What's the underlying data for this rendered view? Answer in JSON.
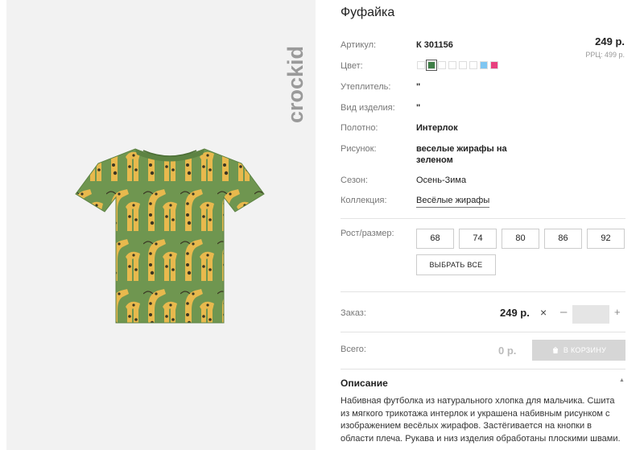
{
  "brand": {
    "logo_text": "crockid"
  },
  "product": {
    "title": "Фуфайка",
    "price": "249 р.",
    "rrp": "РРЦ: 499 р.",
    "attributes": [
      {
        "label": "Артикул:",
        "value": "К 301156"
      },
      {
        "label": "Цвет:"
      },
      {
        "label": "Утеплитель:",
        "value": "\""
      },
      {
        "label": "Вид изделия:",
        "value": "\""
      },
      {
        "label": "Полотно:",
        "value": "Интерлок"
      },
      {
        "label": "Рисунок:",
        "value_line1": "веселые жирафы на",
        "value_line2": "зеленом"
      },
      {
        "label": "Сезон:",
        "value": "Осень-Зима"
      },
      {
        "label": "Коллекция:",
        "value": "Весёлые жирафы"
      }
    ],
    "colors": [
      "#ffffff",
      "#3f7f47",
      "#ffffff",
      "#ffffff",
      "#ffffff",
      "#ffffff",
      "#7fc6f2",
      "#e8407e"
    ],
    "selected_color_index": 1
  },
  "sizes": {
    "label": "Рост/размер:",
    "options": [
      "68",
      "74",
      "80",
      "86",
      "92"
    ],
    "select_all": "ВЫБРАТЬ ВСЕ"
  },
  "order": {
    "label": "Заказ:",
    "price": "249 р.",
    "times": "×",
    "minus": "–",
    "plus": "+",
    "qty": ""
  },
  "total": {
    "label": "Всего:",
    "value": "0 р.",
    "cart_button": "В КОРЗИНУ"
  },
  "description": {
    "heading": "Описание",
    "text": "Набивная футболка из натурального хлопка для мальчика. Сшита из мягкого трикотажа интерлок и украшена набивным рисунком с изображением весёлых жирафов. Застёгивается на кнопки в области плеча. Рукава и низ изделия обработаны плоскими швами."
  }
}
